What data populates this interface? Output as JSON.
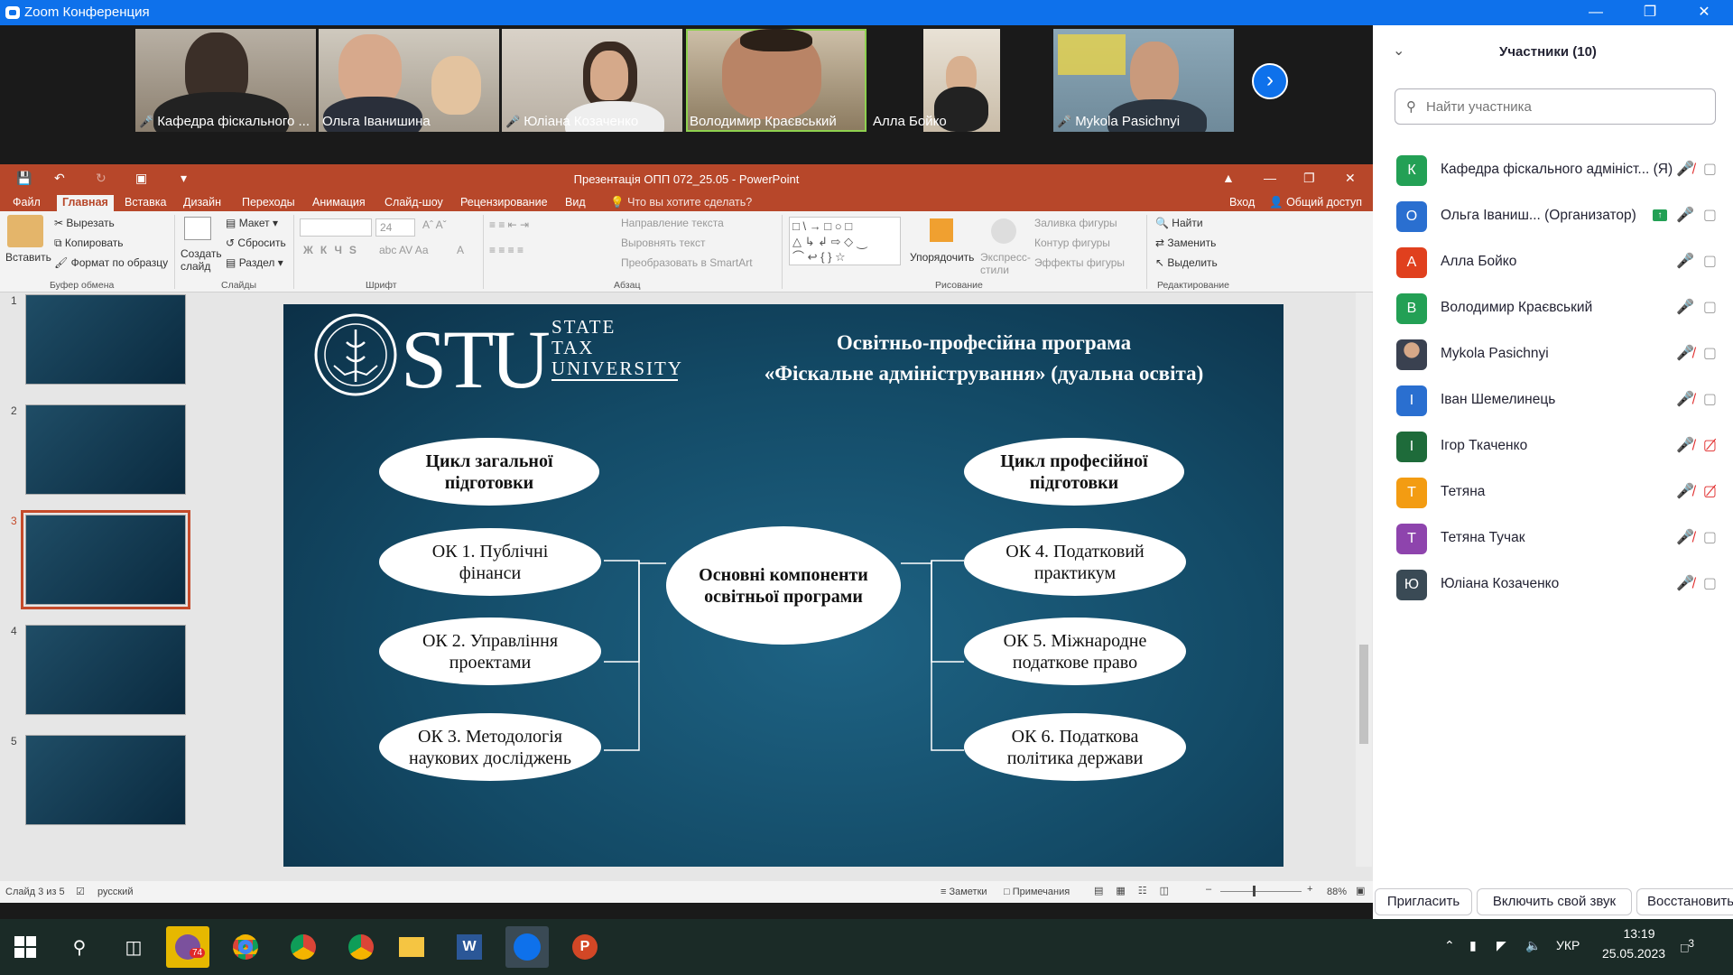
{
  "zoom": {
    "window_title": "Zoom Конференция",
    "video_tiles": [
      {
        "name": "Кафедра фіскального ...",
        "muted": true
      },
      {
        "name": "Ольга Іванишина",
        "muted": false
      },
      {
        "name": "Юліана Козаченко",
        "muted": true
      },
      {
        "name": "Володимир Краєвський",
        "muted": false
      },
      {
        "name": "Алла Бойко",
        "muted": false
      },
      {
        "name": "Mykola Pasichnyi",
        "muted": true
      }
    ],
    "participants_title": "Участники (10)",
    "search_placeholder": "Найти участника",
    "participants": [
      {
        "initial": "К",
        "name": "Кафедра фіскального адмініст...",
        "tag": "(Я)",
        "color": "#23a055",
        "mic": "off",
        "cam": "on"
      },
      {
        "initial": "О",
        "name": "Ольга Іваниш...",
        "tag": "(Организатор)",
        "color": "#2a6fd0",
        "mic": "on",
        "cam": "on",
        "sharing": true
      },
      {
        "initial": "А",
        "name": "Алла Бойко",
        "tag": "",
        "color": "#e0401e",
        "mic": "on",
        "cam": "on"
      },
      {
        "initial": "В",
        "name": "Володимир Краєвський",
        "tag": "",
        "color": "#23a055",
        "mic": "on",
        "cam": "on"
      },
      {
        "initial": "",
        "name": "Mykola Pasichnyi",
        "tag": "",
        "color": "#6b4a3a",
        "mic": "off",
        "cam": "on",
        "photo": true
      },
      {
        "initial": "І",
        "name": "Іван Шемелинець",
        "tag": "",
        "color": "#2a6fd0",
        "mic": "off",
        "cam": "on"
      },
      {
        "initial": "І",
        "name": "Ігор Ткаченко",
        "tag": "",
        "color": "#1e6b3a",
        "mic": "off",
        "cam": "off"
      },
      {
        "initial": "Т",
        "name": "Тетяна",
        "tag": "",
        "color": "#f39c12",
        "mic": "off",
        "cam": "off"
      },
      {
        "initial": "Т",
        "name": "Тетяна Тучак",
        "tag": "",
        "color": "#8e44ad",
        "mic": "off",
        "cam": "on"
      },
      {
        "initial": "Ю",
        "name": "Юліана Козаченко",
        "tag": "",
        "color": "#3a4a55",
        "mic": "off",
        "cam": "on"
      }
    ],
    "buttons": {
      "invite": "Пригласить",
      "unmute": "Включить свой звук",
      "restore": "Восстановить"
    }
  },
  "ppt": {
    "window_title": "Презентація ОПП 072_25.05 - PowerPoint",
    "menu": [
      "Файл",
      "Главная",
      "Вставка",
      "Дизайн",
      "Переходы",
      "Анимация",
      "Слайд-шоу",
      "Рецензирование",
      "Вид"
    ],
    "tell_me": "Что вы хотите сделать?",
    "signin": "Вход",
    "share": "Общий доступ",
    "ribbon": {
      "paste": "Вставить",
      "cut": "Вырезать",
      "copy": "Копировать",
      "format_painter": "Формат по образцу",
      "new_slide": "Создать слайд",
      "layout": "Макет",
      "reset": "Сбросить",
      "section": "Раздел",
      "font_size": "24",
      "text_direction": "Направление текста",
      "align_text": "Выровнять текст",
      "smartart": "Преобразовать в SmartArt",
      "arrange": "Упорядочить",
      "quick_styles": "Экспресс-стили",
      "shape_fill": "Заливка фигуры",
      "shape_outline": "Контур фигуры",
      "shape_effects": "Эффекты фигуры",
      "find": "Найти",
      "replace": "Заменить",
      "select": "Выделить",
      "groups": [
        "Буфер обмена",
        "Слайды",
        "Шрифт",
        "Абзац",
        "Рисование",
        "Редактирование"
      ]
    },
    "slide": {
      "logo_text": "STU",
      "logo_sub1": "STATE",
      "logo_sub2": "TAX",
      "logo_sub3": "UNIVERSITY",
      "title1": "Освітньо-професійна програма",
      "title2": "«Фіскальне адміністрування» (дуальна освіта)",
      "center": "Основні компоненти освітньої програми",
      "left_head": "Цикл загальної підготовки",
      "right_head": "Цикл професійної підготовки",
      "ok1": "ОК 1. Публічні фінанси",
      "ok2": "ОК 2. Управління проектами",
      "ok3": "ОК 3. Методологія наукових досліджень",
      "ok4": "ОК 4. Податковий практикум",
      "ok5": "ОК 5. Міжнародне податкове право",
      "ok6": "ОК 6. Податкова політика держави"
    },
    "thumbnails": [
      "1",
      "2",
      "3",
      "4",
      "5"
    ],
    "status": {
      "slide_of": "Слайд 3 из 5",
      "lang": "русский",
      "notes": "Заметки",
      "comments": "Примечания",
      "zoom": "88%"
    }
  },
  "taskbar": {
    "badge": "74",
    "lang": "УКР",
    "time": "13:19",
    "date": "25.05.2023",
    "notif": "3"
  }
}
